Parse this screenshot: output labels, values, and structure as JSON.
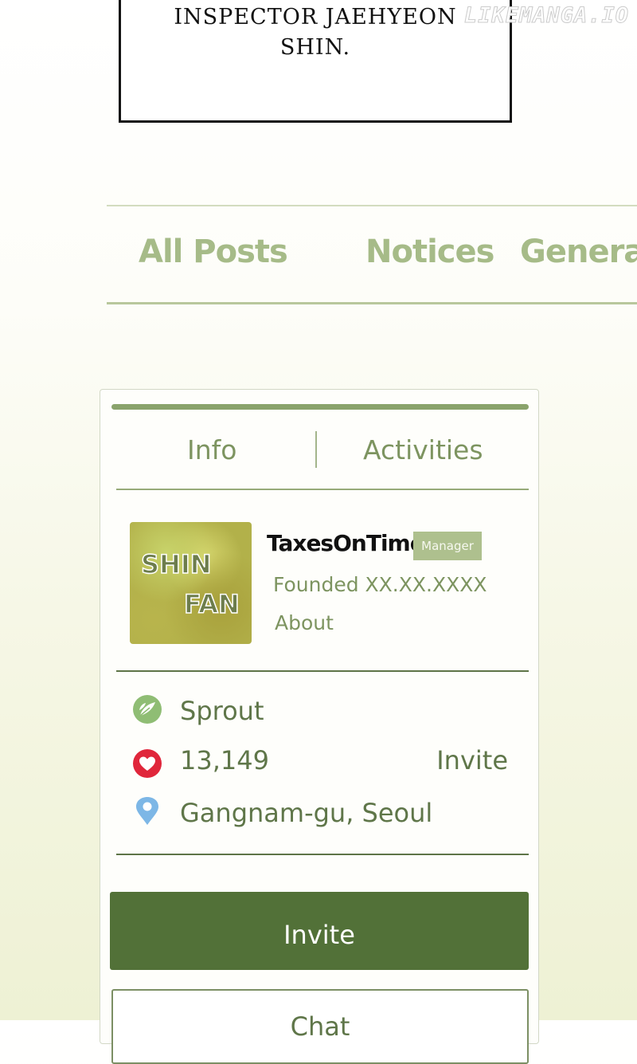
{
  "caption": {
    "line1": "INSPECTOR JAEHYEON",
    "line2": "SHIN."
  },
  "watermark": "LIKEMANGA.IO",
  "board_tabs": [
    "All Posts",
    "Notices",
    "General"
  ],
  "card": {
    "tabs": [
      "Info",
      "Activities"
    ],
    "avatar": {
      "line1": "SHIN",
      "line2": "FAN"
    },
    "username": "TaxesOnTime",
    "role_badge": "Manager",
    "founded": "Founded XX.XX.XXXX",
    "about": "About",
    "level": {
      "icon": "sprout-leaf-icon",
      "label": "Sprout"
    },
    "members": {
      "icon": "heart-icon",
      "count": "13,149",
      "invite_link": "Invite"
    },
    "location": {
      "icon": "location-pin-icon",
      "label": "Gangnam-gu, Seoul"
    },
    "invite_button": "Invite",
    "chat_button": "Chat"
  },
  "colors": {
    "accent_green": "#527138",
    "light_green": "#a6bb88",
    "text_green": "#5f7649",
    "heart_red": "#e0263b",
    "pin_blue": "#7db7e6"
  }
}
